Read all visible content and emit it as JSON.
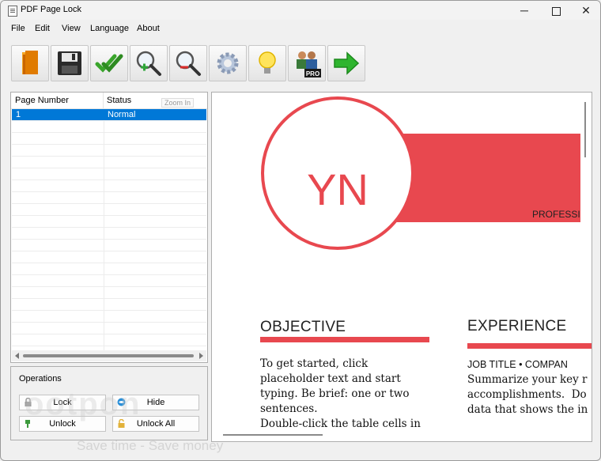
{
  "window": {
    "title": "PDF Page Lock"
  },
  "window_controls": {
    "minimize": "─",
    "close": "✕"
  },
  "menu": [
    "File",
    "Edit",
    "View",
    "Language",
    "About"
  ],
  "toolbar": {
    "buttons": [
      "open-pdf",
      "save",
      "check",
      "zoom-in",
      "zoom-out",
      "settings",
      "help",
      "pro",
      "next"
    ],
    "pro_badge": "PRO",
    "tooltip": "Zoom In"
  },
  "page_list": {
    "columns": [
      "Page Number",
      "Status"
    ],
    "rows": [
      {
        "page": "1",
        "status": "Normal",
        "selected": true
      }
    ]
  },
  "operations": {
    "title": "Operations",
    "lock": "Lock",
    "hide": "Hide",
    "unlock": "Unlock",
    "unlock_all": "Unlock All"
  },
  "preview": {
    "initials": "YN",
    "profession": "PROFESSI",
    "objective_title": "OBJECTIVE",
    "objective_text": "To get started, click\nplaceholder text and start\ntyping. Be brief: one or two\nsentences.\nDouble-click the table cells in",
    "experience_title": "EXPERIENCE",
    "job_line": "JOB TITLE • COMPAN",
    "experience_text": "Summarize your key r\naccomplishments.  Do\ndata that shows the in"
  },
  "watermark": {
    "brand": "ootpon",
    "slogan": "Save time - Save money"
  },
  "colors": {
    "accent_red": "#e8484f",
    "selection_blue": "#0078d7"
  }
}
